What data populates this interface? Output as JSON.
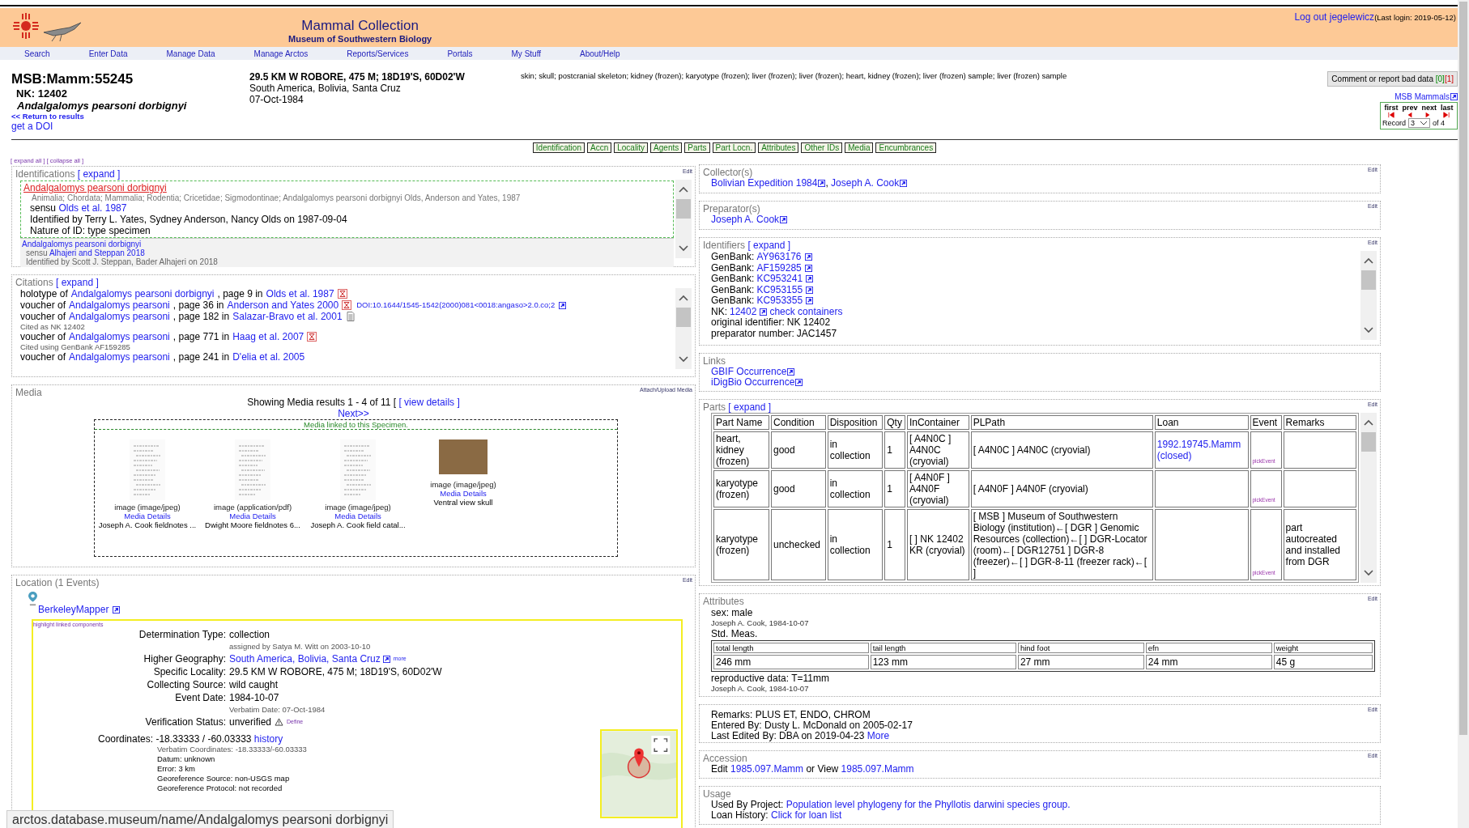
{
  "header": {
    "title": "Mammal Collection",
    "subtitle": "Museum of Southwestern Biology",
    "logout": "Log out jegelewicz",
    "last_login": "(Last login: 2019-05-12)",
    "nav": [
      "Search",
      "Enter Data",
      "Manage Data",
      "Manage Arctos",
      "Reports/Services",
      "Portals",
      "My Stuff",
      "About/Help"
    ]
  },
  "specimen": {
    "guid": "MSB:Mamm:55245",
    "nk": "NK: 12402",
    "taxon": "Andalgalomys pearsoni dorbignyi",
    "return_link": "<< Return to results",
    "doi_link": "get a DOI",
    "locality": "29.5 KM W ROBORE, 475 M; 18D19'S, 60D02'W",
    "geography": "South America, Bolivia, Santa Cruz",
    "date": "07-Oct-1984",
    "parts": "skin; skull; postcranial skeleton; kidney (frozen); karyotype (frozen); liver (frozen); liver (frozen); heart, kidney (frozen); liver (frozen) sample; liver (frozen) sample",
    "comment_button": "Comment or report bad data",
    "good_count": "[0]",
    "bad_count": "[1]",
    "collection_link": "MSB Mammals",
    "pager": {
      "labels": [
        "first",
        "prev",
        "next",
        "last"
      ],
      "record_label": "Record",
      "record": "3",
      "of": "of 4"
    }
  },
  "section_tabs": [
    "Identification",
    "Accn",
    "Locality",
    "Agents",
    "Parts",
    "Part Locn.",
    "Attributes",
    "Other IDs",
    "Media",
    "Encumbrances"
  ],
  "expand_all": "[ expand all ]",
  "collapse_all": "[ collapse all ]",
  "identifications": {
    "title": "Identifications",
    "expand": "[ expand ]",
    "edit": "Edit",
    "items": [
      {
        "accepted": true,
        "taxon": "Andalgalomys pearsoni dorbignyi",
        "classification": "Animalia; Chordata; Mammalia; Rodentia; Cricetidae; Sigmodontinae; Andalgalomys pearsoni dorbignyi Olds, Anderson and Yates, 1987",
        "sensu_label": "sensu",
        "sensu": "Olds et al. 1987",
        "identified_by": "Identified by Terry L. Yates, Sydney Anderson, Nancy Olds on 1987-09-04",
        "nature": "Nature of ID: type specimen"
      },
      {
        "accepted": false,
        "taxon": "Andalgalomys pearsoni dorbignyi",
        "sensu_label": "sensu",
        "sensu": "Alhajeri and Steppan 2018",
        "identified_by": "Identified by Scott J. Steppan, Bader Alhajeri on 2018"
      }
    ]
  },
  "citations": {
    "title": "Citations",
    "expand": "[ expand ]",
    "items": [
      {
        "type_text": "holotype of",
        "taxon": "Andalgalomys pearsoni dorbignyi",
        "page": ", page 9 in",
        "publication": "Olds et al. 1987",
        "kind": "pdf"
      },
      {
        "type_text": "voucher of",
        "taxon": "Andalgalomys pearsoni",
        "page": ", page 36 in",
        "publication": "Anderson and Yates 2000",
        "kind": "pdf",
        "doi": "DOI:10.1644/1545-1542(2000)081<0018:angaso>2.0.co;2"
      },
      {
        "type_text": "voucher of",
        "taxon": "Andalgalomys pearsoni",
        "page": ", page 182 in",
        "publication": "Salazar-Bravo et al. 2001",
        "kind": "document",
        "note": "Cited as NK 12402"
      },
      {
        "type_text": "voucher of",
        "taxon": "Andalgalomys pearsoni",
        "page": ", page 771 in",
        "publication": "Haag et al. 2007",
        "kind": "pdf",
        "note": "Cited using GenBank AF159285"
      },
      {
        "type_text": "voucher of",
        "taxon": "Andalgalomys pearsoni",
        "page": ", page 241 in",
        "publication": "D'elia et al. 2005",
        "kind": "plain"
      }
    ]
  },
  "media": {
    "title": "Media",
    "attach": "Attach/Upload Media",
    "summary": "Showing Media results 1 - 4 of 11 [",
    "view_details": "[ view details ]",
    "next": "Next>>",
    "linked_label": "Media linked to this Specimen.",
    "items": [
      {
        "kind": "document",
        "type": "image (image/jpeg)",
        "details": "Media Details",
        "caption": "Joseph A. Cook fieldnotes ..."
      },
      {
        "kind": "document",
        "type": "image (application/pdf)",
        "details": "Media Details",
        "caption": "Dwight Moore fieldnotes 6..."
      },
      {
        "kind": "document",
        "type": "image (image/jpeg)",
        "details": "Media Details",
        "caption": "Joseph A. Cook field catal..."
      },
      {
        "kind": "photo",
        "type": "image (image/jpeg)",
        "details": "Media Details",
        "caption": "Ventral view skull"
      }
    ]
  },
  "location": {
    "title": "Location (1 Events)",
    "edit": "Edit",
    "mapper": "BerkeleyMapper",
    "highlight": "highlight linked components",
    "fields": [
      {
        "kind": "text",
        "label": "Determination Type:",
        "value": "collection",
        "note": "assigned by Satya M. Witt on 2003-10-10"
      },
      {
        "kind": "link",
        "label": "Higher Geography:",
        "value": "South America, Bolivia, Santa Cruz",
        "extra": "more"
      },
      {
        "kind": "text",
        "label": "Specific Locality:",
        "value": "29.5 KM W ROBORE, 475 M; 18D19'S, 60D02'W"
      },
      {
        "kind": "text",
        "label": "Collecting Source:",
        "value": "wild caught"
      },
      {
        "kind": "text",
        "label": "Event Date:",
        "value": "1984-10-07",
        "note": "Verbatim Date: 07-Oct-1984"
      },
      {
        "kind": "status",
        "label": "Verification Status:",
        "value": "unverified",
        "extra": "Define"
      }
    ],
    "coordinates": {
      "label": "Coordinates:",
      "value": "-18.33333 / -60.03333",
      "history": "history",
      "details": [
        "Verbatim Coordinates: -18.33333/-60.03333",
        "Datum: unknown",
        "Error: 3 km",
        "Georeference Source: non-USGS map",
        "Georeference Protocol: not recorded"
      ]
    }
  },
  "collectors": {
    "title": "Collector(s)",
    "edit": "Edit",
    "separator": ", ",
    "links": [
      "Bolivian Expedition 1984",
      "Joseph A. Cook"
    ]
  },
  "preparators": {
    "title": "Preparator(s)",
    "edit": "Edit",
    "links": [
      "Joseph A. Cook"
    ]
  },
  "identifiers": {
    "title": "Identifiers",
    "expand": "[ expand ]",
    "edit": "Edit",
    "items": [
      {
        "kind": "link",
        "label": "GenBank:",
        "value": "AY963176"
      },
      {
        "kind": "link",
        "label": "GenBank:",
        "value": "AF159285"
      },
      {
        "kind": "link",
        "label": "GenBank:",
        "value": "KC953241"
      },
      {
        "kind": "link",
        "label": "GenBank:",
        "value": "KC953155"
      },
      {
        "kind": "link",
        "label": "GenBank:",
        "value": "KC953355"
      },
      {
        "kind": "link",
        "label": "NK:",
        "value": "12402",
        "extra": "check containers"
      },
      {
        "kind": "text",
        "label": "original identifier:",
        "value": "NK 12402"
      },
      {
        "kind": "text",
        "label": "preparator number:",
        "value": "JAC1457"
      }
    ]
  },
  "links": {
    "title": "Links",
    "items": [
      "GBIF Occurrence",
      "iDigBio Occurrence"
    ]
  },
  "parts": {
    "title": "Parts",
    "expand": "[ expand ]",
    "edit": "Edit",
    "columns": [
      "Part Name",
      "Condition",
      "Disposition",
      "Qty",
      "InContainer",
      "PLPath",
      "Loan",
      "Event",
      "Remarks"
    ],
    "rows": [
      {
        "part_name": "heart, kidney (frozen)",
        "condition": "good",
        "disposition": "in collection",
        "qty": "1",
        "container": "[ A4N0C ] A4N0C (cryovial)",
        "path": "[ A4N0C ] A4N0C (cryovial)",
        "loan": "1992.19745.Mamm (closed)",
        "event": "pickEvent"
      },
      {
        "part_name": "karyotype (frozen)",
        "condition": "good",
        "disposition": "in collection",
        "qty": "1",
        "container": "[ A4N0F ] A4N0F (cryovial)",
        "path": "[ A4N0F ] A4N0F (cryovial)",
        "event": "pickEvent"
      },
      {
        "part_name": "karyotype (frozen)",
        "condition": "unchecked",
        "disposition": "in collection",
        "qty": "1",
        "container": "[ ] NK 12402 KR (cryovial)",
        "path": "[ MSB ] Museum of Southwestern Biology (institution)←[ DGR ] Genomic Resources (collection)←[ ] DGR-Locator (room)←[ DGR12751 ] DGR-8 (freezer)←[ ] DGR-8-11 (freezer rack)←[ ]",
        "event": "pickEvent",
        "remarks": "part autocreated and installed from DGR"
      }
    ]
  },
  "attributes": {
    "title": "Attributes",
    "edit": "Edit",
    "sex": "sex: male",
    "sex_by": "Joseph A. Cook, 1984-10-07",
    "std_label": "Std. Meas.",
    "measurements": [
      {
        "name": "total length",
        "value": "246 mm"
      },
      {
        "name": "tail length",
        "value": "123 mm"
      },
      {
        "name": "hind foot",
        "value": "27 mm"
      },
      {
        "name": "efn",
        "value": "24 mm"
      },
      {
        "name": "weight",
        "value": "45 g"
      }
    ],
    "repro": "reproductive data: T=11mm",
    "repro_by": "Joseph A. Cook, 1984-10-07"
  },
  "remarks": {
    "edit": "Edit",
    "remarks": "Remarks: PLUS ET, ENDO, CHROM",
    "entered": "Entered By: Dusty L. McDonald on 2005-02-17",
    "edited": "Last Edited By: DBA on 2019-04-23",
    "more": "More"
  },
  "accession": {
    "title": "Accession",
    "edit": "Edit",
    "edit_label": "Edit",
    "edit_link": "1985.097.Mamm",
    "view_label": "or View",
    "view_link": "1985.097.Mamm"
  },
  "usage": {
    "title": "Usage",
    "project_label": "Used By Project:",
    "project": "Population level phylogeny for the Phyllotis darwini species group.",
    "loan_label": "Loan History:",
    "loan": "Click for loan list"
  },
  "status_bar": "arctos.database.museum/name/Andalgalomys pearsoni dorbignyi"
}
